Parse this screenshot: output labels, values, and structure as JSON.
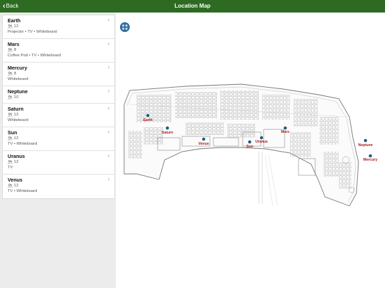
{
  "nav": {
    "back_label": "Back",
    "title": "Location Map"
  },
  "rooms": [
    {
      "name": "Earth",
      "capacity": "12",
      "features": "Projector • TV • Whiteboard"
    },
    {
      "name": "Mars",
      "capacity": "8",
      "features": "Coffee Pod • TV • Whiteboard"
    },
    {
      "name": "Mercury",
      "capacity": "8",
      "features": "Whiteboard"
    },
    {
      "name": "Neptune",
      "capacity": "10",
      "features": ""
    },
    {
      "name": "Saturn",
      "capacity": "12",
      "features": "Whiteboard"
    },
    {
      "name": "Sun",
      "capacity": "12",
      "features": "TV • Whiteboard"
    },
    {
      "name": "Uranus",
      "capacity": "12",
      "features": "TV"
    },
    {
      "name": "Venus",
      "capacity": "12",
      "features": "TV • Whiteboard"
    }
  ],
  "map": {
    "pins": [
      {
        "name": "Earth"
      },
      {
        "name": "Saturn"
      },
      {
        "name": "Venus"
      },
      {
        "name": "Sun"
      },
      {
        "name": "Uranus"
      },
      {
        "name": "Mars"
      },
      {
        "name": "Neptune"
      },
      {
        "name": "Mercury"
      }
    ]
  },
  "colors": {
    "nav_bar": "#2e6b22",
    "pin": "#1f5f7a",
    "pin_label": "#b01818",
    "fullscreen_button": "#2f6da3"
  },
  "icons": {
    "back": "chevron-left-icon",
    "capacity": "people-icon",
    "row": "chevron-right-icon",
    "fullscreen": "expand-icon",
    "pin": "map-pin-icon"
  }
}
